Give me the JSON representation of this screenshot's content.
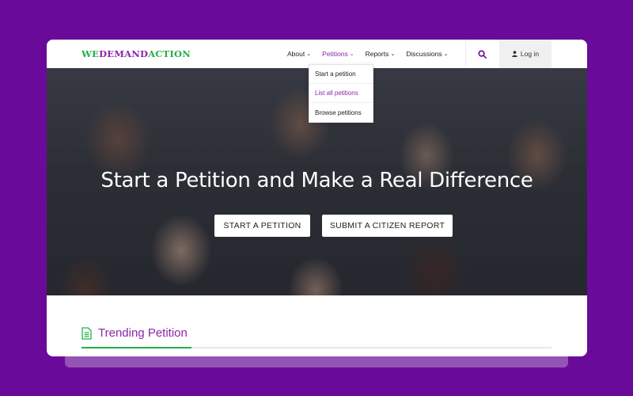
{
  "logo": {
    "part1": "WE",
    "part2": "DEMAND",
    "part3": "ACTION"
  },
  "nav": {
    "items": [
      {
        "label": "About",
        "active": false
      },
      {
        "label": "Petitions",
        "active": true
      },
      {
        "label": "Reports",
        "active": false
      },
      {
        "label": "Discussions",
        "active": false
      }
    ],
    "search_icon": "search-icon",
    "login_label": "Log in",
    "login_icon": "user-icon"
  },
  "dropdown": {
    "items": [
      {
        "label": "Start a petition"
      },
      {
        "label": "List all petitions"
      },
      {
        "label": "Browse petitions"
      }
    ]
  },
  "hero": {
    "title": "Start a Petition and Make a Real Difference",
    "primary_button": "START A PETITION",
    "secondary_button": "SUBMIT A CITIZEN REPORT"
  },
  "trending": {
    "title": "Trending Petition",
    "icon": "document-icon"
  },
  "colors": {
    "page_bg": "#6a0a9a",
    "brand_purple": "#8e24aa",
    "brand_green": "#22b04a"
  }
}
